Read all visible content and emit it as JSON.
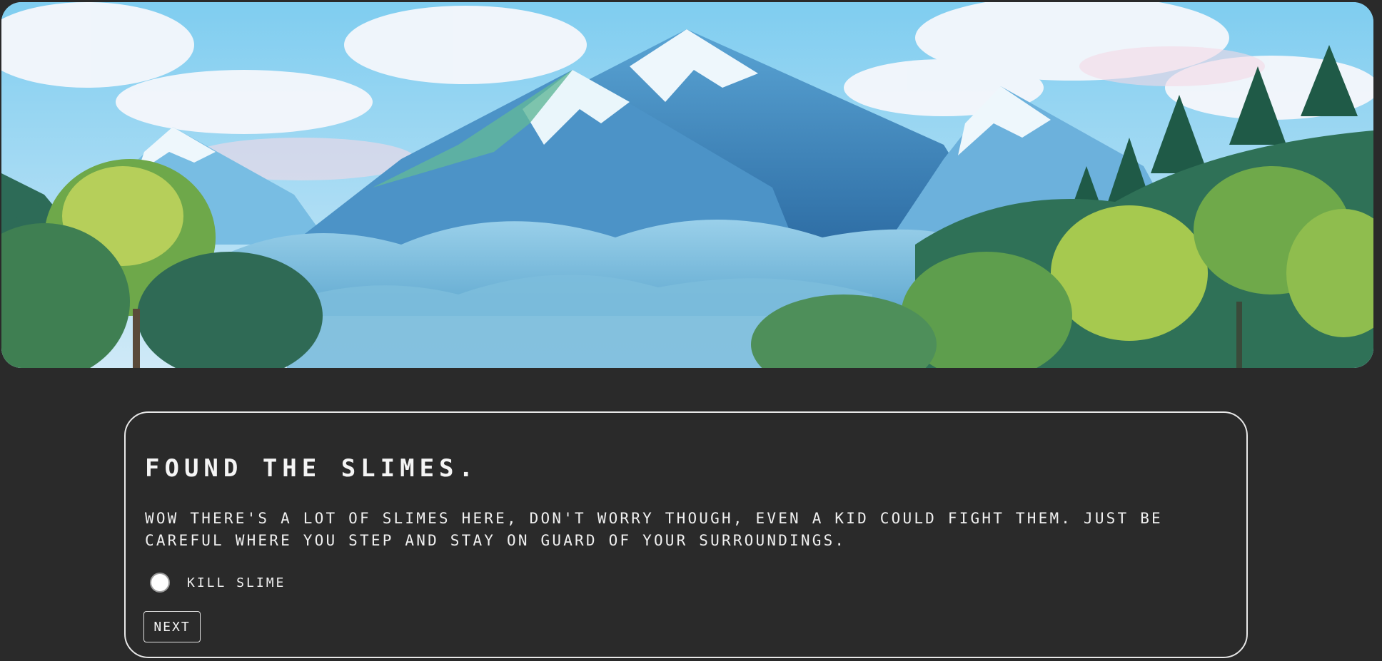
{
  "scene": {
    "image_icon": "mountain-landscape-illustration"
  },
  "story": {
    "title": "FOUND THE SLIMES.",
    "description": "WOW THERE'S A LOT OF SLIMES HERE, DON'T WORRY THOUGH, EVEN A KID COULD FIGHT THEM. JUST BE CAREFUL WHERE YOU STEP AND STAY ON GUARD OF YOUR SURROUNDINGS.",
    "options": [
      {
        "label": "KILL SLIME",
        "selected": false
      }
    ],
    "next_label": "NEXT"
  },
  "colors": {
    "background": "#2a2a2a",
    "card_border": "#e8e8e8",
    "text": "#f0f0f0"
  }
}
